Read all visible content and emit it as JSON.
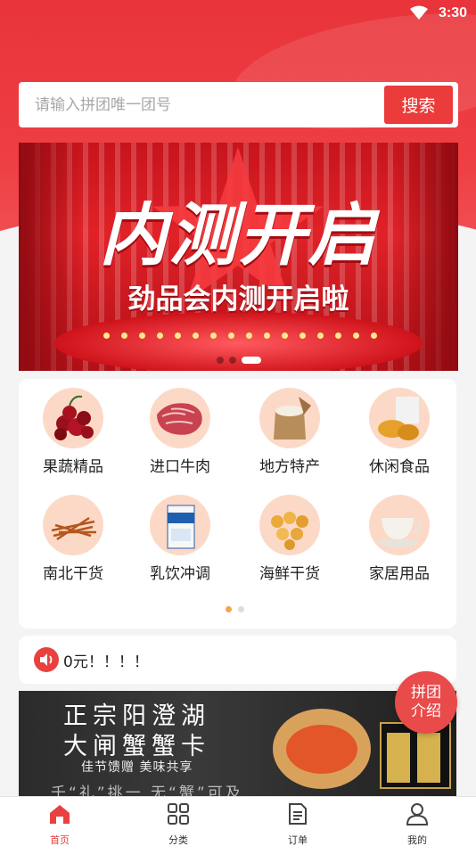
{
  "status_bar": {
    "time": "3:30"
  },
  "search": {
    "placeholder": "请输入拼团唯一团号",
    "button_label": "搜索"
  },
  "banner": {
    "title": "内测开启",
    "subtitle": "劲品会内测开启啦",
    "pages": 3,
    "active_page": 2
  },
  "categories": [
    {
      "label": "果蔬精品",
      "icon": "cherries-icon"
    },
    {
      "label": "进口牛肉",
      "icon": "beef-icon"
    },
    {
      "label": "地方特产",
      "icon": "rice-sack-icon"
    },
    {
      "label": "休闲食品",
      "icon": "snacks-icon"
    },
    {
      "label": "南北干货",
      "icon": "cordyceps-icon"
    },
    {
      "label": "乳饮冲调",
      "icon": "milk-carton-icon"
    },
    {
      "label": "海鲜干货",
      "icon": "scallops-icon"
    },
    {
      "label": "家居用品",
      "icon": "teacup-icon"
    }
  ],
  "category_pager": {
    "pages": 2,
    "active_page": 1
  },
  "notice": {
    "text": "0元！！！！",
    "icon": "speaker-icon"
  },
  "promo": {
    "line1": "正宗阳澄湖",
    "line2": "大闸蟹蟹卡",
    "line3": "佳节馈赠 美味共享",
    "line4": "千“礼”挑一 无“蟹”可及"
  },
  "float_button": {
    "line1": "拼团",
    "line2": "介绍"
  },
  "tabbar": {
    "items": [
      {
        "label": "首页",
        "icon": "home-icon",
        "active": true
      },
      {
        "label": "分类",
        "icon": "grid-icon",
        "active": false
      },
      {
        "label": "订单",
        "icon": "document-icon",
        "active": false
      },
      {
        "label": "我的",
        "icon": "user-icon",
        "active": false
      }
    ]
  },
  "colors": {
    "brand_red": "#e94040",
    "search_button": "#eb3b3b",
    "pager_active": "#f6a24d"
  }
}
